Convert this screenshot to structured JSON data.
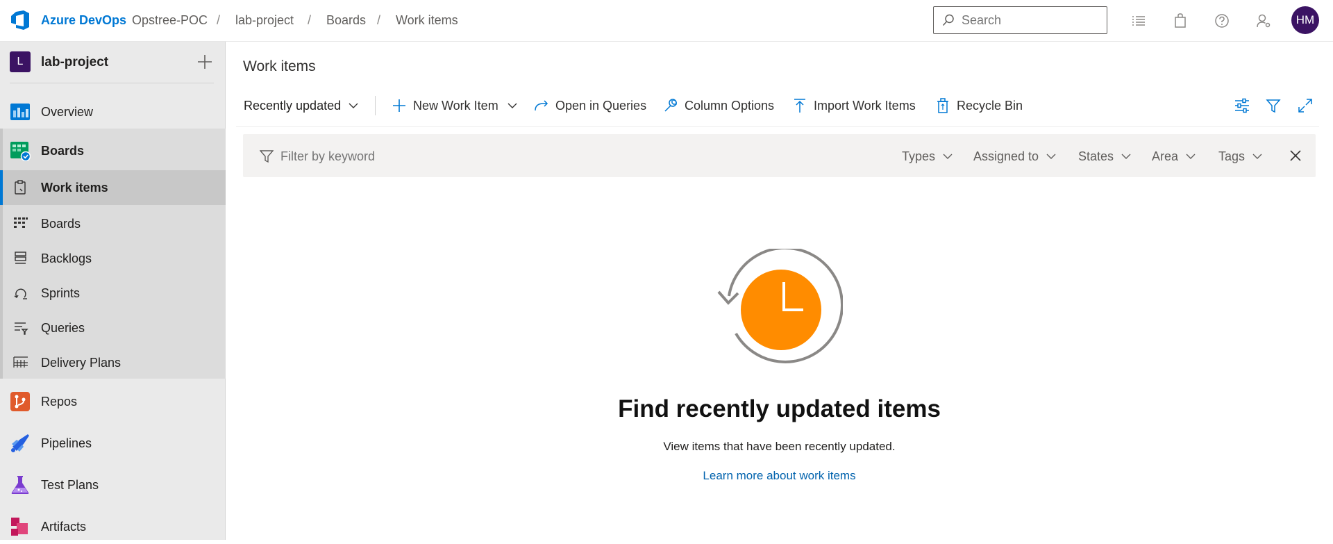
{
  "header": {
    "brand": "Azure DevOps",
    "breadcrumbs": [
      "Opstree-POC",
      "lab-project",
      "Boards",
      "Work items"
    ],
    "separator": "/",
    "search_placeholder": "Search",
    "avatar_initials": "HM",
    "icons": [
      "list-icon",
      "shopping-bag-icon",
      "help-icon",
      "user-settings-icon"
    ]
  },
  "sidebar": {
    "project_initial": "L",
    "project_name": "lab-project",
    "items": [
      {
        "label": "Overview",
        "icon": "overview-icon"
      },
      {
        "label": "Boards",
        "icon": "boards-hub-icon"
      },
      {
        "label": "Work items",
        "icon": "work-items-icon",
        "selected": true
      },
      {
        "label": "Boards",
        "icon": "boards-grid-icon"
      },
      {
        "label": "Backlogs",
        "icon": "backlogs-icon"
      },
      {
        "label": "Sprints",
        "icon": "sprints-icon"
      },
      {
        "label": "Queries",
        "icon": "queries-icon"
      },
      {
        "label": "Delivery Plans",
        "icon": "delivery-plans-icon"
      },
      {
        "label": "Repos",
        "icon": "repos-icon"
      },
      {
        "label": "Pipelines",
        "icon": "pipelines-icon"
      },
      {
        "label": "Test Plans",
        "icon": "test-plans-icon"
      },
      {
        "label": "Artifacts",
        "icon": "artifacts-icon"
      }
    ]
  },
  "main": {
    "title": "Work items",
    "toolbar": {
      "view_select": "Recently updated",
      "new_work_item": "New Work Item",
      "open_in_queries": "Open in Queries",
      "column_options": "Column Options",
      "import_work_items": "Import Work Items",
      "recycle_bin": "Recycle Bin"
    },
    "filter": {
      "placeholder": "Filter by keyword",
      "dropdowns": [
        "Types",
        "Assigned to",
        "States",
        "Area",
        "Tags"
      ]
    },
    "empty_state": {
      "title": "Find recently updated items",
      "subtitle": "View items that have been recently updated.",
      "link": "Learn more about work items"
    }
  },
  "colors": {
    "accent": "#0078d4",
    "avatar": "#3b1363",
    "clock": "#ff8c00"
  }
}
